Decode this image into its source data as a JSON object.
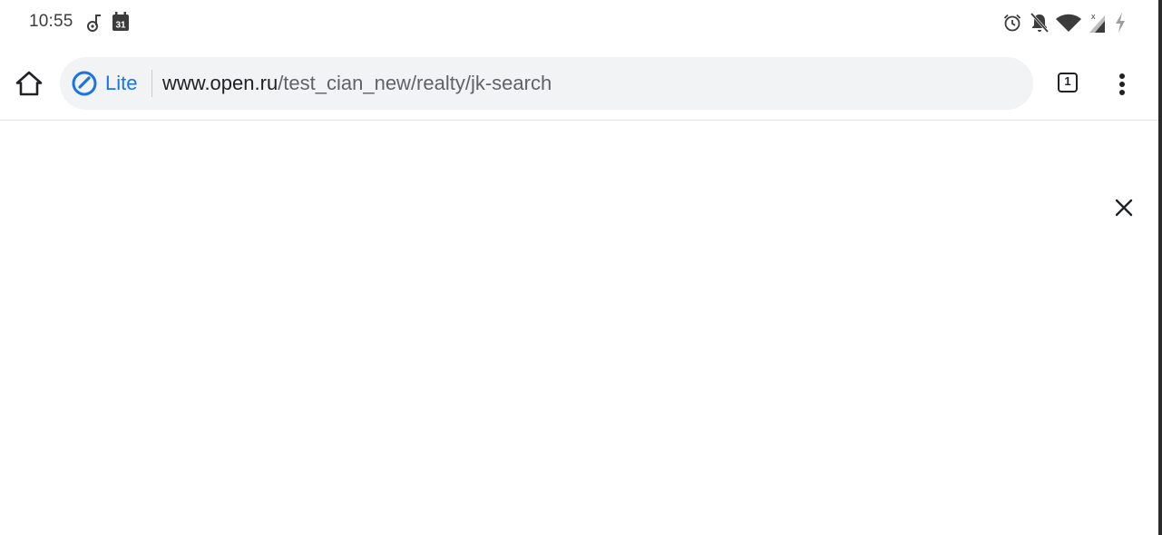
{
  "status_bar": {
    "time": "10:55",
    "left_icons": [
      "music-note-icon",
      "calendar-icon"
    ],
    "calendar_day": "31",
    "right_icons": [
      "alarm-icon",
      "notifications-off-icon",
      "wifi-icon",
      "signal-no-service-icon",
      "charging-bolt-icon"
    ],
    "signal_marker": "x"
  },
  "toolbar": {
    "home_icon": "home-icon",
    "omnibox": {
      "badge_icon": "speedometer-icon",
      "badge_label": "Lite",
      "url_host": "www.open.ru",
      "url_path": "/test_cian_new/realty/jk-search"
    },
    "tab_count": "1",
    "menu_icon": "more-vert-icon"
  },
  "content": {
    "close_icon": "close-icon"
  },
  "colors": {
    "accent": "#1a73e8",
    "omnibox_bg": "#f1f3f4",
    "text_primary": "#202124",
    "text_secondary": "#5f6368"
  }
}
